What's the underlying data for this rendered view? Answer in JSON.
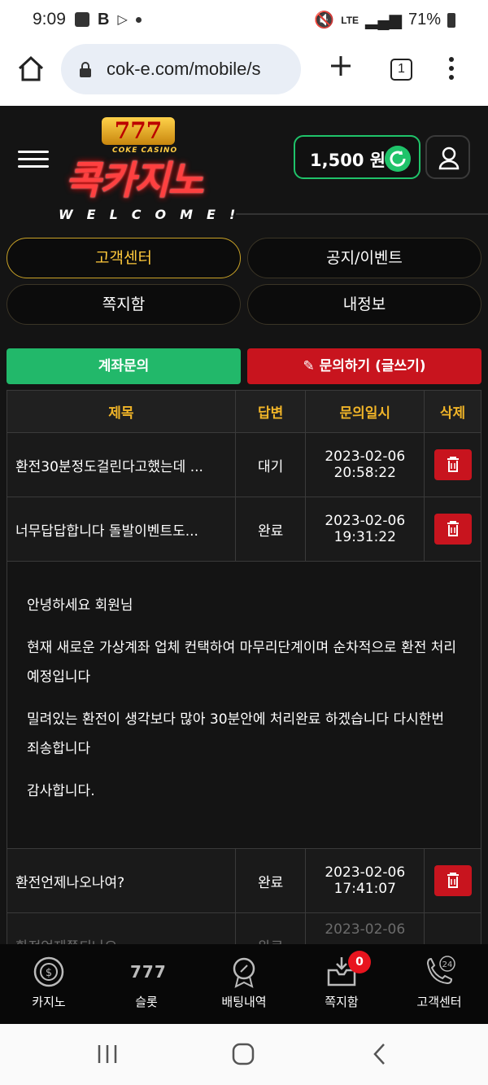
{
  "status": {
    "time": "9:09",
    "network": "LTE",
    "battery": "71%"
  },
  "browser": {
    "url": "cok-e.com/mobile/s",
    "tab_count": "1"
  },
  "header": {
    "logo_sevens": "777",
    "logo_sub": "COKE CASINO",
    "logo_text": "콕카지노",
    "welcome": "WELCOME!",
    "balance": "1,500 원"
  },
  "menu": {
    "customer_center": "고객센터",
    "notice_event": "공지/이벤트",
    "messages": "쪽지함",
    "my_info": "내정보"
  },
  "actions": {
    "account_inquiry": "계좌문의",
    "write_inquiry": "문의하기 (글쓰기)"
  },
  "table": {
    "headers": [
      "제목",
      "답변",
      "문의일시",
      "삭제"
    ],
    "rows": [
      {
        "title": "환전30분정도걸린다고했는데 ...",
        "status": "대기",
        "date": "2023-02-06",
        "time": "20:58:22"
      },
      {
        "title": "너무답답합니다 돌발이벤트도...",
        "status": "완료",
        "date": "2023-02-06",
        "time": "19:31:22"
      },
      {
        "title": "환전언제나오나여?",
        "status": "완료",
        "date": "2023-02-06",
        "time": "17:41:07"
      },
      {
        "title": "환전언제쯤되나요",
        "status": "완료",
        "date": "2023-02-06"
      }
    ],
    "reply": {
      "greeting": "안녕하세요 회원님",
      "p1": "현재 새로운 가상계좌 업체 컨택하여 마무리단계이며 순차적으로 환전 처리예정입니다",
      "p2": "밀려있는 환전이 생각보다 많아 30분안에 처리완료 하겠습니다 다시한번 죄송합니다",
      "p3": "감사합니다."
    }
  },
  "bottom_nav": {
    "casino": "카지노",
    "slot": "슬롯",
    "bet_history": "배팅내역",
    "messages": "쪽지함",
    "messages_badge": "0",
    "support": "고객센터",
    "support_icon_text": "24",
    "slot_icon_text": "777"
  },
  "colors": {
    "accent_gold": "#f0b428",
    "green": "#22b86a",
    "red": "#c8141e",
    "background": "#141414"
  }
}
